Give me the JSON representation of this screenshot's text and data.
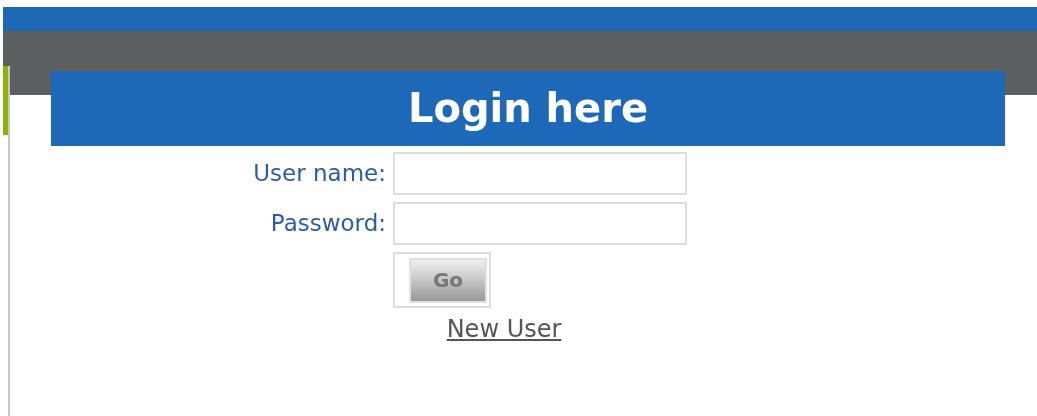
{
  "header": {
    "title": "Login here"
  },
  "fields": [
    {
      "label": "User name:"
    },
    {
      "label": "Password:"
    }
  ],
  "submit_button": {
    "label": "Go"
  },
  "link": {
    "label": "New User"
  }
}
